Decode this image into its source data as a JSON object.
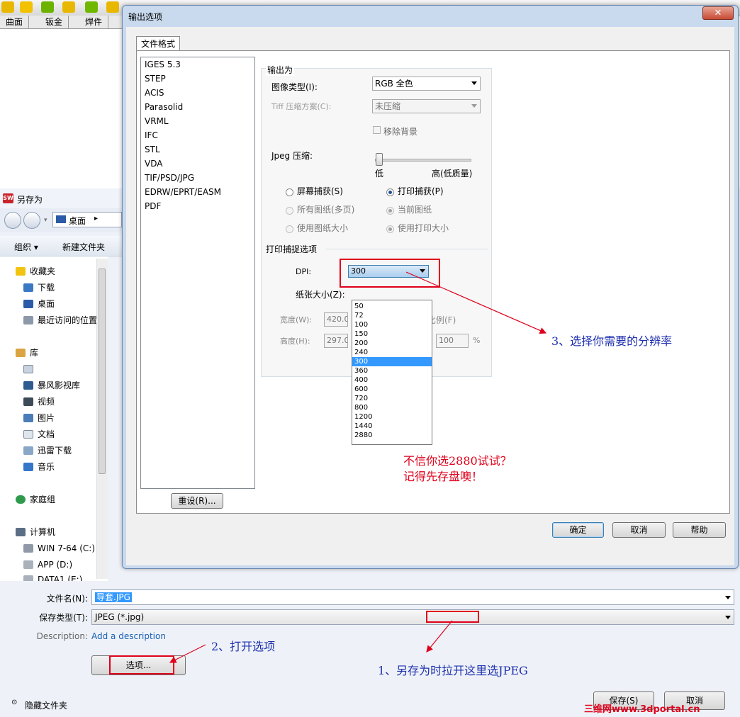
{
  "app": {
    "tabs": [
      "曲面",
      "钣金",
      "焊件"
    ]
  },
  "save_as": {
    "title": "另存为",
    "logo_text": "SW",
    "address": "桌面",
    "organize": "组织 ▾",
    "new_folder": "新建文件夹",
    "tree": [
      {
        "label": "收藏夹",
        "icon": "star-icon"
      },
      {
        "label": "下载",
        "icon": "download-folder-icon"
      },
      {
        "label": "桌面",
        "icon": "desktop-icon"
      },
      {
        "label": "最近访问的位置",
        "icon": "recent-places-icon"
      },
      {
        "label": "库",
        "icon": "library-icon"
      },
      {
        "label": "",
        "icon": "document-icon"
      },
      {
        "label": "暴风影视库",
        "icon": "video-library-icon"
      },
      {
        "label": "视频",
        "icon": "video-icon"
      },
      {
        "label": "图片",
        "icon": "picture-icon"
      },
      {
        "label": "文档",
        "icon": "document-icon"
      },
      {
        "label": "迅雷下载",
        "icon": "thunder-download-icon"
      },
      {
        "label": "音乐",
        "icon": "music-icon"
      },
      {
        "label": "家庭组",
        "icon": "homegroup-icon"
      },
      {
        "label": "计算机",
        "icon": "computer-icon"
      },
      {
        "label": "WIN 7-64 (C:)",
        "icon": "drive-c-icon"
      },
      {
        "label": "APP (D:)",
        "icon": "drive-icon"
      },
      {
        "label": "DATA1 (E:)",
        "icon": "drive-icon"
      }
    ],
    "filename_label": "文件名(N):",
    "filename_value": "导套.JPG",
    "filetype_label": "保存类型(T):",
    "filetype_value": "JPEG (*.jpg)",
    "description_label": "Description:",
    "description_link": "Add a description",
    "options_button": "选项...",
    "hide_folders": "隐藏文件夹",
    "save_button": "保存(S)",
    "cancel_button": "取消"
  },
  "options_dialog": {
    "title": "输出选项",
    "close": "✕",
    "tab": "文件格式",
    "formats": [
      "IGES 5.3",
      "STEP",
      "ACIS",
      "Parasolid",
      "VRML",
      "IFC",
      "STL",
      "VDA",
      "TIF/PSD/JPG",
      "EDRW/EPRT/EASM",
      "PDF"
    ],
    "selected_format": "TIF/PSD/JPG",
    "output_as": "输出为",
    "image_type_label": "图像类型(I):",
    "image_type_value": "RGB 全色",
    "tiff_label": "Tiff 压缩方案(C):",
    "tiff_value": "未压缩",
    "remove_bg": "移除背景",
    "jpeg_label": "Jpeg 压缩:",
    "jpeg_quality": 0.0,
    "jpeg_low": "低",
    "jpeg_high": "高(低质量)",
    "screen_capture": "屏幕捕获(S)",
    "print_capture": "打印捕获(P)",
    "all_sheets": "所有图纸(多页)",
    "current_sheet": "当前图纸",
    "use_sheet_size": "使用图纸大小",
    "use_print_size": "使用打印大小",
    "print_options": "打印捕捉选项",
    "dpi_label": "DPI:",
    "dpi_value": "300",
    "paper_size_label": "纸张大小(Z):",
    "width_label": "宽度(W):",
    "width_value": "420.00",
    "height_label": "高度(H):",
    "height_value": "297.00",
    "scale_label": "比例(F)",
    "scale_value": "100",
    "percent": "%",
    "dpi_options": [
      "50",
      "72",
      "100",
      "150",
      "200",
      "240",
      "300",
      "360",
      "400",
      "600",
      "720",
      "800",
      "1200",
      "1440",
      "2880"
    ],
    "reset": "重设(R)...",
    "ok": "确定",
    "cancel": "取消",
    "help": "帮助"
  },
  "annotations": {
    "step1": "1、另存为时拉开这里选JPEG",
    "step2": "2、打开选项",
    "step3": "3、选择你需要的分辨率",
    "warning_line1": "不信你选2880试试？",
    "warning_line2": "记得先存盘噢！",
    "watermark": "三维网www.3dportal.cn"
  },
  "colors": {
    "annotation_blue": "#1d2fae",
    "annotation_red": "#e0001b",
    "selection_blue": "#3399ff"
  }
}
